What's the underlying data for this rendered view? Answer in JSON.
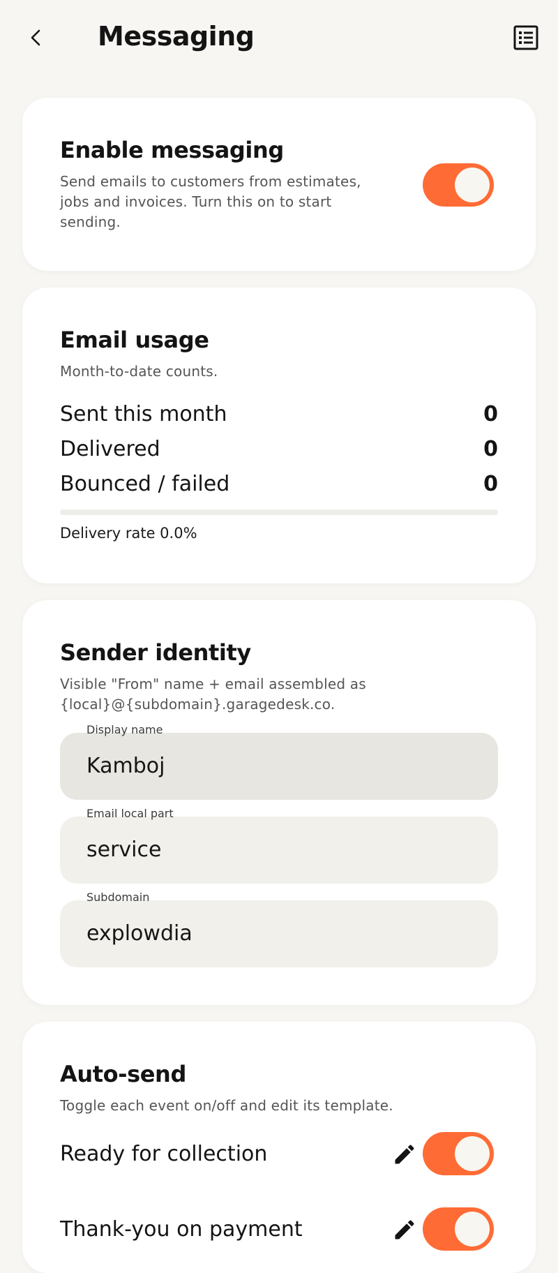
{
  "header": {
    "title": "Messaging",
    "back_icon": "chevron-left-icon",
    "action_icon": "list-icon"
  },
  "enable_messaging": {
    "title": "Enable messaging",
    "description": "Send emails to customers from estimates, jobs and invoices. Turn this on to start sending.",
    "enabled": true
  },
  "email_usage": {
    "title": "Email usage",
    "subtitle": "Month-to-date counts.",
    "stats": [
      {
        "label": "Sent this month",
        "value": "0"
      },
      {
        "label": "Delivered",
        "value": "0"
      },
      {
        "label": "Bounced / failed",
        "value": "0"
      }
    ],
    "delivery_rate_fraction": 0.0,
    "delivery_rate_text": "Delivery rate 0.0%"
  },
  "sender_identity": {
    "title": "Sender identity",
    "description": "Visible \"From\" name + email assembled as {local}@{subdomain}.garagedesk.co.",
    "fields": [
      {
        "label": "Display name",
        "value": "Kamboj"
      },
      {
        "label": "Email local part",
        "value": "service"
      },
      {
        "label": "Subdomain",
        "value": "explowdia"
      }
    ]
  },
  "auto_send": {
    "title": "Auto-send",
    "description": "Toggle each event on/off and edit its template.",
    "events": [
      {
        "label": "Ready for collection",
        "enabled": true,
        "edit_icon": "pencil-icon"
      },
      {
        "label": "Thank-you on payment",
        "enabled": true,
        "edit_icon": "pencil-icon"
      }
    ]
  },
  "colors": {
    "accent": "#ff6b35",
    "background": "#f7f6f3",
    "card": "#ffffff",
    "field": "#f1f0eb"
  }
}
